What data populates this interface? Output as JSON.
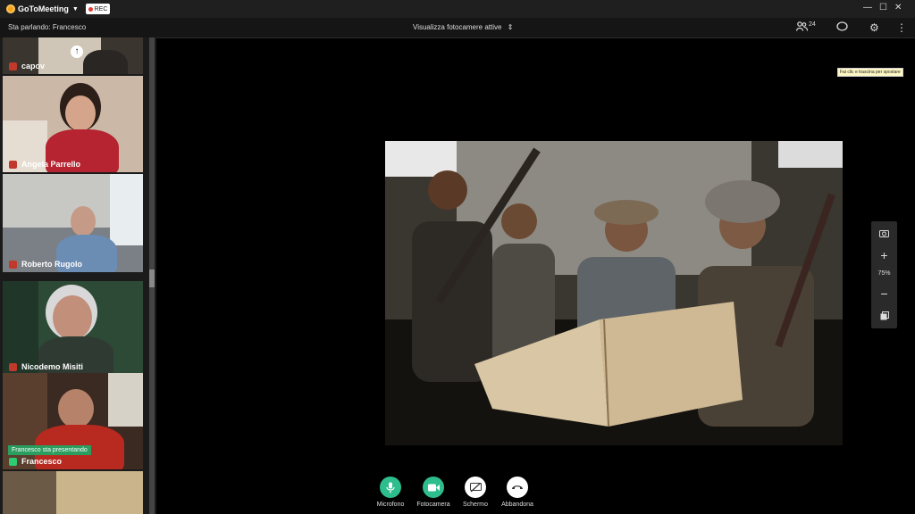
{
  "titlebar": {
    "app_name": "GoToMeeting",
    "rec_label": "REC",
    "minimize": "—",
    "maximize": "☐",
    "close": "✕"
  },
  "infobar": {
    "speaking_label": "Sta parlando: Francesco",
    "view_selector": "Visualizza fotocamere attive",
    "attendee_count": "24"
  },
  "participants": [
    {
      "name": "capov"
    },
    {
      "name": "Angela Parrello"
    },
    {
      "name": "Roberto Rugolo"
    },
    {
      "name": "Nicodemo Misiti"
    },
    {
      "name": "Francesco"
    }
  ],
  "presenting_label": "Francesco sta presentando",
  "tooltip": "Fai clic e trascina per spostare",
  "zoom": {
    "level": "75%"
  },
  "controls": {
    "mic": "Microfono",
    "camera": "Fotocamera",
    "screen": "Schermo",
    "leave": "Abbandona"
  },
  "colors": {
    "accent_green": "#2ebd8c",
    "muted_red": "#c0392b",
    "rec_red": "#e53935"
  }
}
